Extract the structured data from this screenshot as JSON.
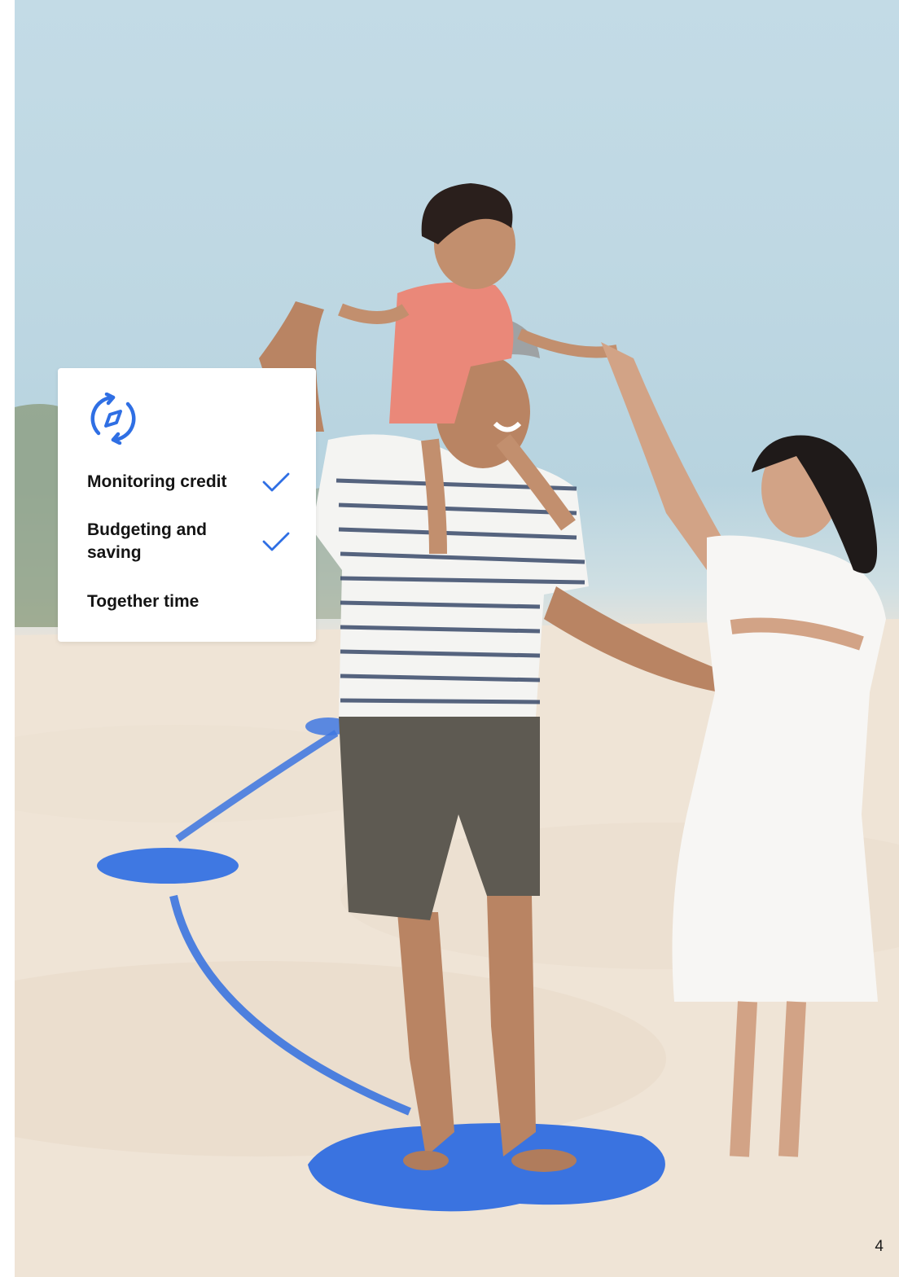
{
  "card": {
    "icon": "compass-sync-icon",
    "items": [
      {
        "label": "Monitoring credit",
        "checked": true
      },
      {
        "label": "Budgeting and saving",
        "checked": true
      },
      {
        "label": "Together time",
        "checked": false
      }
    ]
  },
  "page_number": "4",
  "colors": {
    "accent": "#2f6fe4",
    "card_bg": "#ffffff",
    "text": "#141414"
  }
}
